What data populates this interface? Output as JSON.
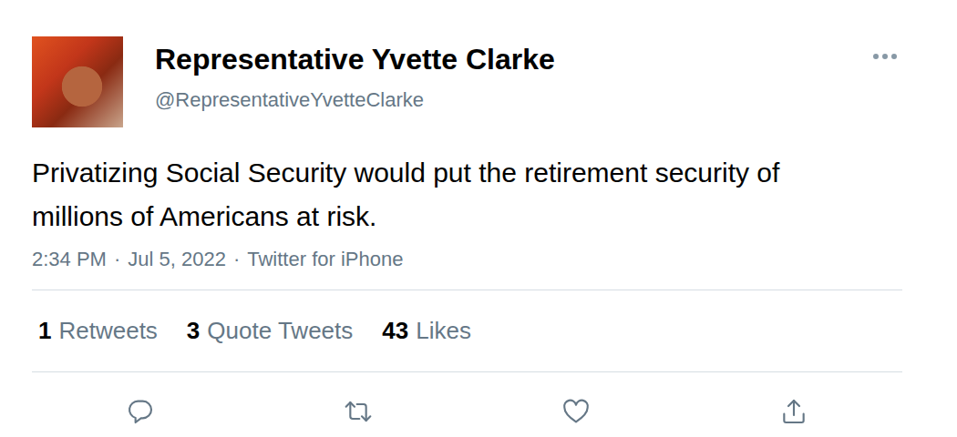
{
  "tweet": {
    "author": {
      "name": "Representative Yvette Clarke",
      "handle": "@RepresentativeYvetteClarke"
    },
    "more": "•••",
    "text": "Privatizing Social Security would put the retirement security of millions of Americans at risk.",
    "meta": {
      "time": "2:34 PM",
      "date": "Jul 5, 2022",
      "source": "Twitter for iPhone",
      "separator": "·"
    },
    "stats": [
      {
        "count": "1",
        "label": "Retweets"
      },
      {
        "count": "3",
        "label": "Quote Tweets"
      },
      {
        "count": "43",
        "label": "Likes"
      }
    ]
  }
}
